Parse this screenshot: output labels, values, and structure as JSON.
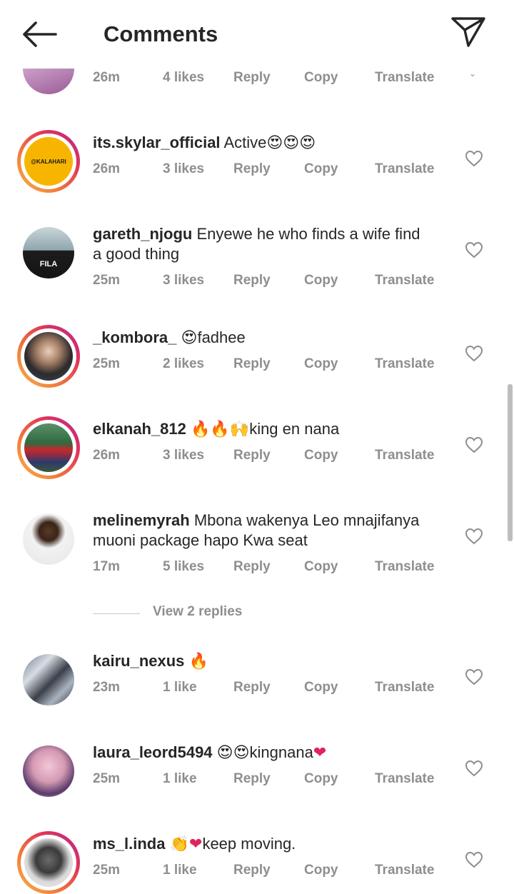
{
  "header": {
    "title": "Comments",
    "back_icon": "arrow-left-icon",
    "send_icon": "paper-plane-icon"
  },
  "partial_comment": {
    "time": "26m",
    "likes": "4 likes",
    "reply": "Reply",
    "copy": "Copy",
    "translate": "Translate"
  },
  "comments": [
    {
      "username": "its.skylar_official",
      "text": "Active",
      "emoji": "😍😍😍",
      "time": "26m",
      "likes": "3 likes",
      "reply": "Reply",
      "copy": "Copy",
      "translate": "Translate",
      "avatar_text": "@KALAHARI"
    },
    {
      "username": "gareth_njogu",
      "text": "Enyewe he who finds a wife find",
      "text2": "a good thing",
      "time": "25m",
      "likes": "3 likes",
      "reply": "Reply",
      "copy": "Copy",
      "translate": "Translate",
      "avatar_text": "FILA"
    },
    {
      "username": "_kombora_",
      "emoji": "😍",
      "text": "fadhee",
      "time": "25m",
      "likes": "2 likes",
      "reply": "Reply",
      "copy": "Copy",
      "translate": "Translate"
    },
    {
      "username": "elkanah_812",
      "emoji": "🔥🔥🙌",
      "text": "king en nana",
      "time": "26m",
      "likes": "3 likes",
      "reply": "Reply",
      "copy": "Copy",
      "translate": "Translate"
    },
    {
      "username": "melinemyrah",
      "text": "Mbona wakenya Leo mnajifanya",
      "text2": "muoni package hapo Kwa seat",
      "time": "17m",
      "likes": "5 likes",
      "reply": "Reply",
      "copy": "Copy",
      "translate": "Translate"
    },
    {
      "username": "kairu_nexus",
      "emoji": "🔥",
      "time": "23m",
      "likes": "1 like",
      "reply": "Reply",
      "copy": "Copy",
      "translate": "Translate"
    },
    {
      "username": "laura_leord5494",
      "emoji": "😍😍",
      "text": "kingnana",
      "emoji2": "❤",
      "time": "25m",
      "likes": "1 like",
      "reply": "Reply",
      "copy": "Copy",
      "translate": "Translate"
    },
    {
      "username": "ms_l.inda",
      "emoji": "👏❤",
      "text": "keep moving.",
      "time": "25m",
      "likes": "1 like",
      "reply": "Reply",
      "copy": "Copy",
      "translate": "Translate"
    }
  ],
  "view_replies": "View 2 replies",
  "colors": {
    "text": "#262626",
    "muted": "#8e8e8e",
    "story_ring_start": "#f9b44a",
    "story_ring_end": "#b32b8f",
    "heart_red": "#e0245e"
  }
}
